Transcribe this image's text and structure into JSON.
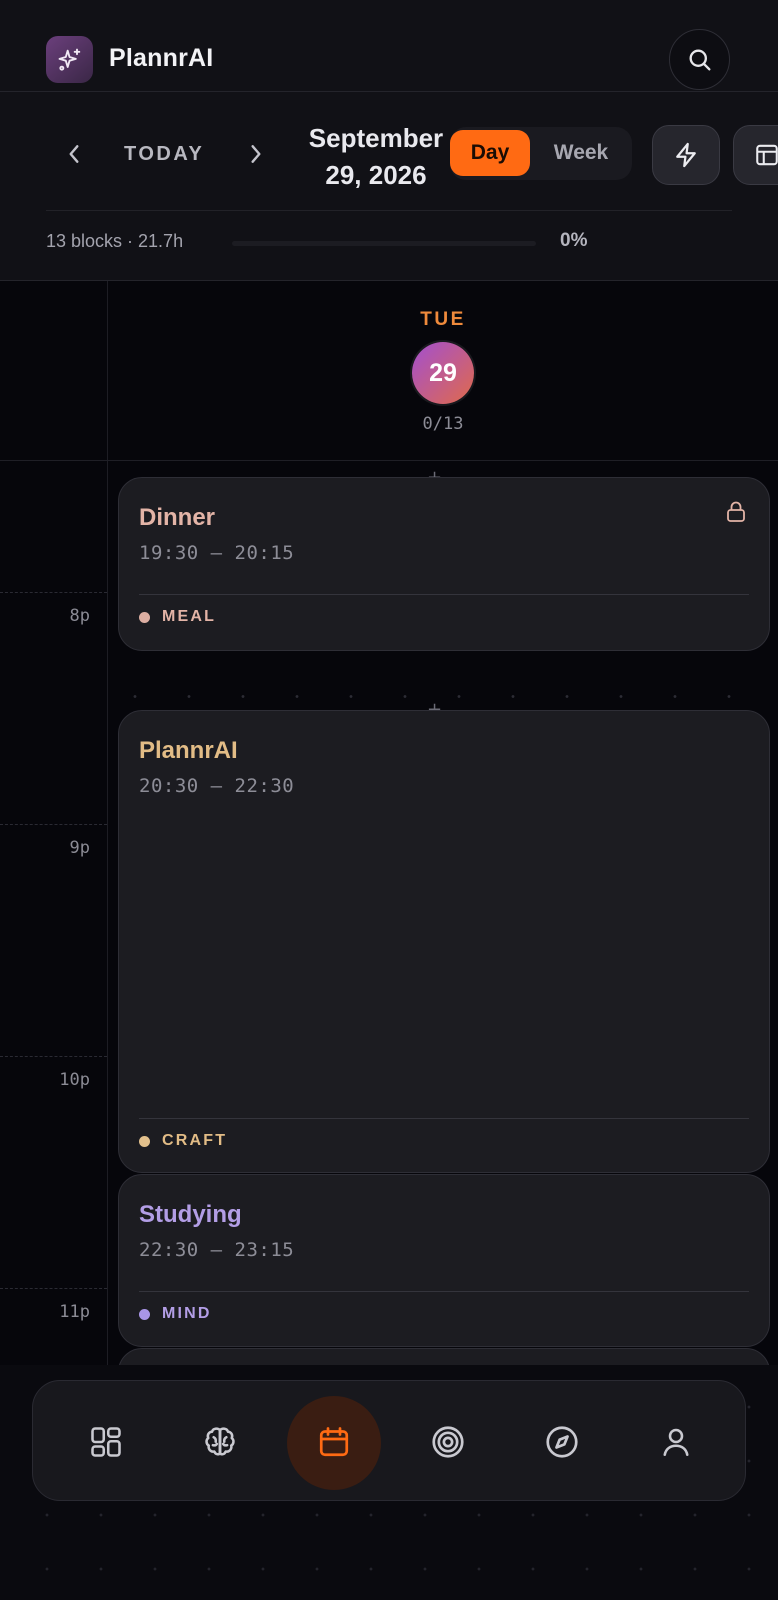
{
  "app": {
    "name": "PlannrAI"
  },
  "header": {
    "logo_icon": "sparkles-icon",
    "search_icon": "search-icon"
  },
  "date_nav": {
    "prev_icon": "chevron-left-icon",
    "today_label": "TODAY",
    "next_icon": "chevron-right-icon",
    "date_line1": "September",
    "date_line2": "29, 2026",
    "view_options": [
      {
        "label": "Day",
        "selected": true
      },
      {
        "label": "Week",
        "selected": false
      }
    ],
    "actions": [
      {
        "icon": "bolt-icon"
      },
      {
        "icon": "layout-icon"
      }
    ],
    "stats": "13 blocks · 21.7h",
    "progress": {
      "value_percent": 0,
      "label": "0%"
    }
  },
  "day_header": {
    "weekday": "TUE",
    "day_number": "29",
    "completed": "0/13"
  },
  "timeline": {
    "hour_labels": [
      "8p",
      "9p",
      "10p",
      "11p"
    ],
    "blocks": [
      {
        "title": "Dinner",
        "time": "19:30 – 20:15",
        "category": "MEAL",
        "color": "#e3b4a7",
        "dot_color": "#dcaea2",
        "locked": true
      },
      {
        "title": "PlannrAI",
        "time": "20:30 – 22:30",
        "category": "CRAFT",
        "color": "#e2bc86",
        "dot_color": "#e2c08c",
        "locked": false
      },
      {
        "title": "Studying",
        "time": "22:30 – 23:15",
        "category": "MIND",
        "color": "#b39ee6",
        "dot_color": "#a996e8",
        "locked": false
      }
    ]
  },
  "bottom_nav": {
    "items": [
      {
        "icon": "dashboard-icon",
        "active": false
      },
      {
        "icon": "brain-icon",
        "active": false
      },
      {
        "icon": "calendar-icon",
        "active": true
      },
      {
        "icon": "target-icon",
        "active": false
      },
      {
        "icon": "compass-icon",
        "active": false
      },
      {
        "icon": "user-icon",
        "active": false
      }
    ]
  },
  "colors": {
    "accent": "#ff6a13",
    "background": "#06060b",
    "card": "#1c1c21"
  }
}
